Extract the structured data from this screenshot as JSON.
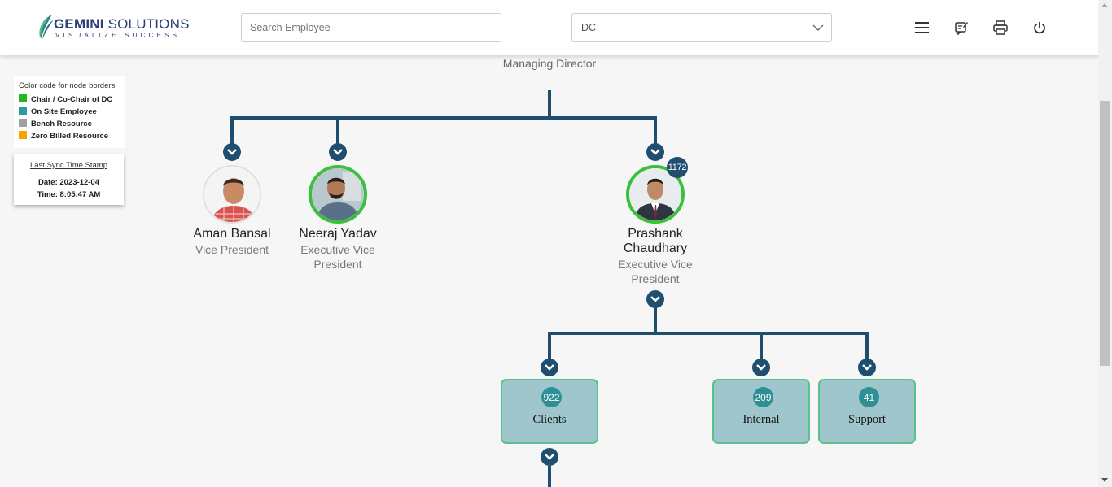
{
  "header": {
    "logo_brand_bold": "GEMINI",
    "logo_brand_rest": " SOLUTIONS",
    "logo_tagline": "VISUALIZE SUCCESS",
    "search_placeholder": "Search Employee",
    "dept_select_value": "DC",
    "icons": [
      "menu-icon",
      "feedback-icon",
      "print-icon",
      "power-icon"
    ]
  },
  "legend": {
    "title": "Color code for node borders",
    "items": [
      {
        "label": "Chair / Co-Chair of DC",
        "color": "#22b822"
      },
      {
        "label": "On Site Employee",
        "color": "#2f9aa0"
      },
      {
        "label": "Bench Resource",
        "color": "#a0a0a0"
      },
      {
        "label": "Zero Billed Resource",
        "color": "#f5a300"
      }
    ]
  },
  "sync": {
    "title": "Last Sync Time Stamp",
    "date_line": "Date: 2023-12-04",
    "time_line": "Time: 8:05:47 AM"
  },
  "tree": {
    "root_title": "Managing Director",
    "employees": [
      {
        "name": "Aman Bansal",
        "role": "Vice President",
        "border": "none"
      },
      {
        "name": "Neeraj Yadav",
        "role_line1": "Executive Vice",
        "role_line2": "President",
        "border": "#3cbf3c"
      },
      {
        "name_line1": "Prashank",
        "name_line2": "Chaudhary",
        "role_line1": "Executive Vice",
        "role_line2": "President",
        "count": "1172",
        "border": "#3cbf3c"
      }
    ],
    "departments": [
      {
        "label": "Clients",
        "count": "922"
      },
      {
        "label": "Internal",
        "count": "209"
      },
      {
        "label": "Support",
        "count": "41"
      }
    ]
  },
  "colors": {
    "tree_line": "#1f4e6e",
    "dept_fill": "#9fc6cc",
    "dept_border": "#5cc08a",
    "badge": "#2f8f96"
  }
}
